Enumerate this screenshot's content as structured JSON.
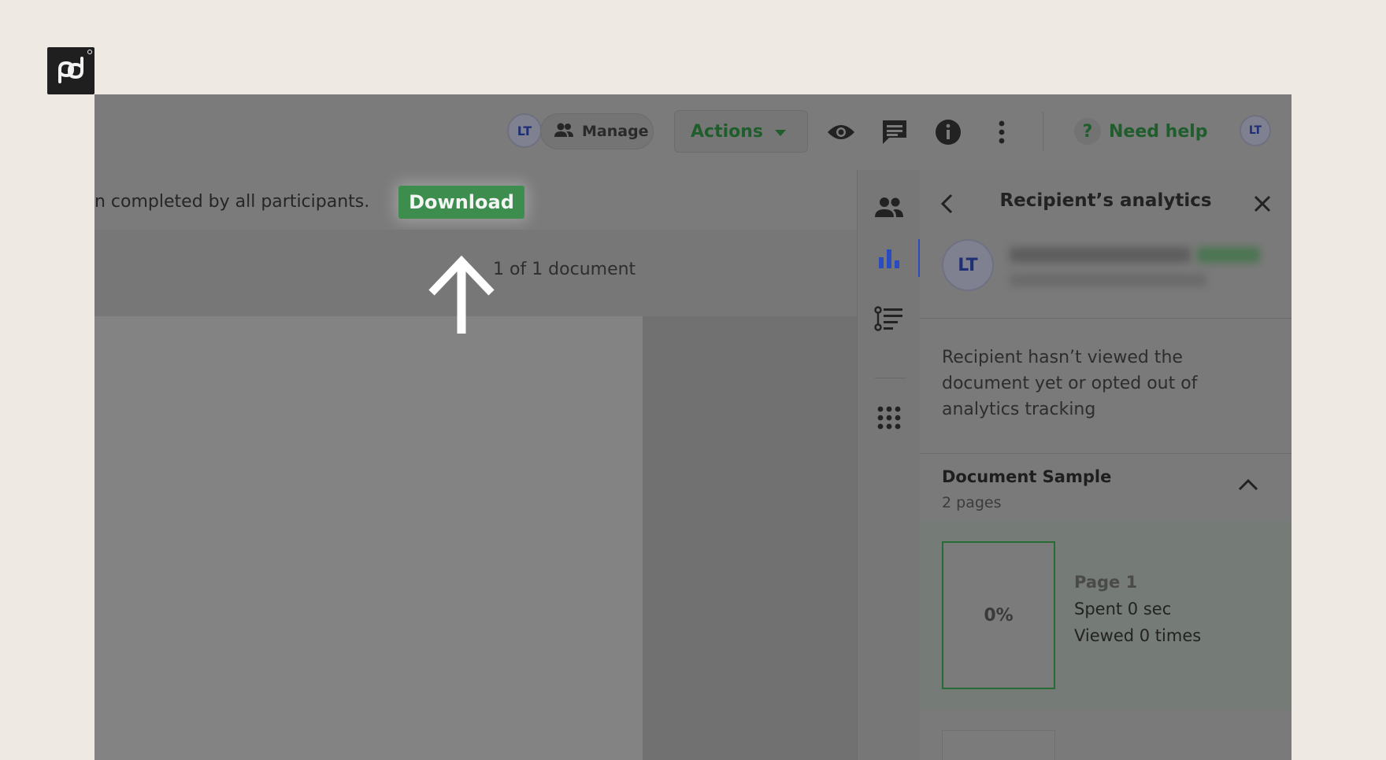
{
  "toolbar": {
    "owner_initials": "LT",
    "manage_label": "Manage",
    "actions_label": "Actions",
    "help_label": "Need help",
    "help_mark": "?",
    "user_initials": "LT"
  },
  "banner": {
    "message": "n completed by all participants.",
    "download_label": "Download"
  },
  "document_view": {
    "count_label": "1 of 1 document"
  },
  "panel": {
    "title": "Recipient’s analytics",
    "recipient_initials": "LT",
    "note": "Recipient hasn’t viewed the document yet or opted out of analytics tracking",
    "document": {
      "name": "Document Sample",
      "pages": "2 pages"
    },
    "page_stats": [
      {
        "label": "Page 1",
        "percent": "0%",
        "spent": "Spent 0 sec",
        "viewed": "Viewed 0 times"
      }
    ]
  },
  "colors": {
    "accent_green": "#3d8d4f",
    "active_blue": "#2b4cc0",
    "page_background": "#eee9e2",
    "dim_overlay": "#7a7a7a"
  },
  "icons": {
    "brand": "pandadoc-logo",
    "arrow": "arrow-up-icon"
  }
}
